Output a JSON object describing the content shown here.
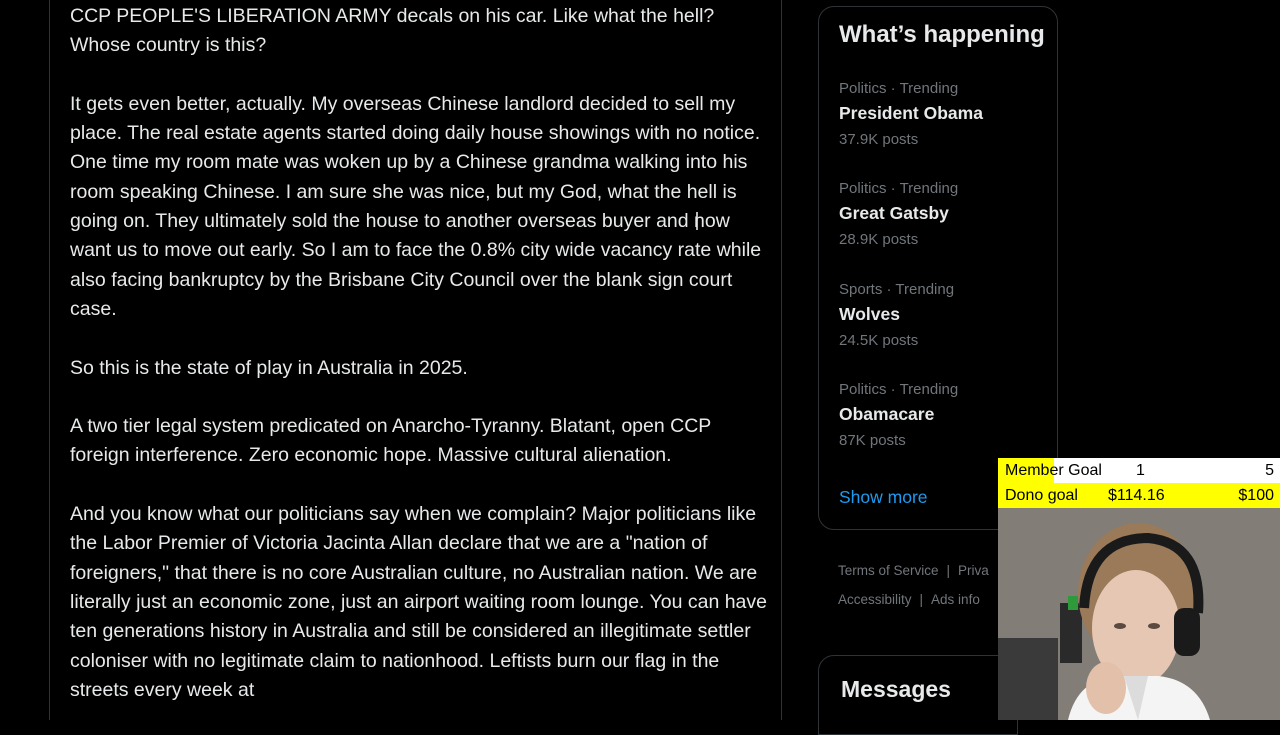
{
  "tweet": {
    "paragraphs": [
      "CCP PEOPLE'S LIBERATION ARMY decals on his car. Like what the hell? Whose country is this?",
      "It gets even better, actually. My overseas Chinese landlord decided to sell my place. The real estate agents started doing daily house showings with no notice. One time my room mate was woken up by a Chinese grandma walking into his room speaking Chinese. I am sure she was nice, but my God, what the hell is going on. They ultimately sold the house to another overseas buyer and now want us to move out early. So I am to face the 0.8% city wide vacancy rate while also facing bankruptcy by the Brisbane City Council over the blank sign court case.",
      "So this is the state of play in Australia in 2025.",
      "A two tier legal system predicated on Anarcho-Tyranny. Blatant, open CCP foreign interference. Zero economic hope. Massive cultural alienation.",
      "And you know what our politicians say when we complain? Major politicians like the Labor Premier of Victoria Jacinta Allan declare that we are a \"nation of foreigners,\" that there is no core Australian culture, no Australian nation. We are literally just an economic zone, just an airport waiting room lounge. You can have ten generations history in Australia and still be considered an illegitimate settler coloniser with no legitimate claim to nationhood. Leftists burn our flag in the streets every week at"
    ]
  },
  "sidebar": {
    "title": "What’s happening",
    "trends": [
      {
        "meta": "Politics · Trending",
        "name": "President Obama",
        "count": "37.9K posts"
      },
      {
        "meta": "Politics · Trending",
        "name": "Great Gatsby",
        "count": "28.9K posts"
      },
      {
        "meta": "Sports · Trending",
        "name": "Wolves",
        "count": "24.5K posts"
      },
      {
        "meta": "Politics · Trending",
        "name": "Obamacare",
        "count": "87K posts"
      }
    ],
    "show_more": "Show more",
    "footer": {
      "terms": "Terms of Service",
      "privacy": "Priva",
      "accessibility": "Accessibility",
      "ads": "Ads info",
      "sep": "|"
    },
    "messages_title": "Messages"
  },
  "overlay": {
    "member_goal": {
      "label": "Member Goal",
      "current": "1",
      "target": "5",
      "progress": 0.2
    },
    "dono_goal": {
      "label": "Dono goal",
      "current": "$114.16",
      "target": "$100",
      "progress": 1.0
    }
  },
  "colors": {
    "background": "#000000",
    "text": "#e7e9ea",
    "muted": "#71767b",
    "link": "#1d9bf0",
    "border": "#2f3336",
    "goal_yellow": "#ffff00"
  }
}
